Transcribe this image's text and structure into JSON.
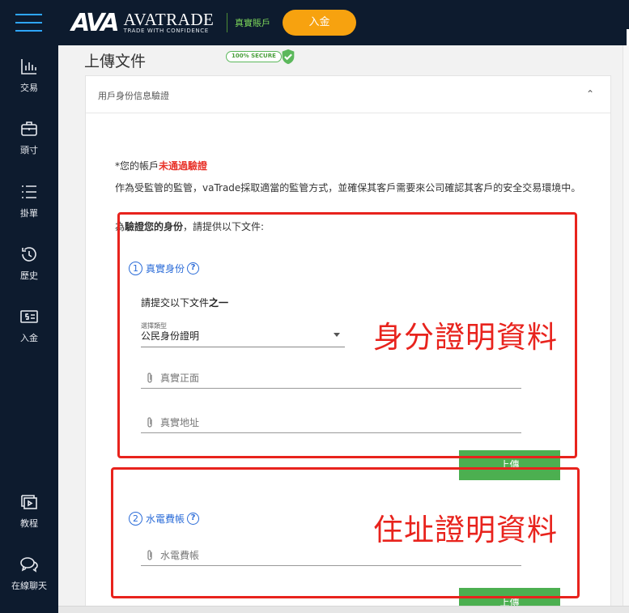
{
  "header": {
    "logo_mark": "AVA",
    "brand_name": "AVATRADE",
    "brand_tagline": "TRADE WITH CONFIDENCE",
    "account_type": "真實賬戶",
    "deposit_label": "入金"
  },
  "sidebar": {
    "items": [
      {
        "label": "交易",
        "icon": "chart-bars-icon"
      },
      {
        "label": "頭寸",
        "icon": "briefcase-icon"
      },
      {
        "label": "掛單",
        "icon": "list-icon"
      },
      {
        "label": "歷史",
        "icon": "history-icon"
      },
      {
        "label": "入金",
        "icon": "deposit-icon"
      }
    ],
    "bottom_items": [
      {
        "label": "教程",
        "icon": "video-tutorial-icon"
      },
      {
        "label": "在線聊天",
        "icon": "chat-icon"
      }
    ]
  },
  "page": {
    "title": "上傳文件",
    "secure_badge": "100% SECURE"
  },
  "card": {
    "header_title": "用戶身份信息驗證",
    "status_prefix": "*您的帳戶",
    "status_value": "未通過驗證",
    "description": "作為受監管的監管，vaTrade採取適當的監管方式，並確保其客戶需要來公司確認其客戶的安全交易環境中。",
    "request_prefix": "為",
    "request_bold": "驗證您的身份",
    "request_suffix": "，請提供以下文件:"
  },
  "identity_section": {
    "number": "1",
    "title": "真實身份",
    "help": "?",
    "instruction_prefix": "請提交以下文件",
    "instruction_bold": "之一",
    "select_label": "選擇類型",
    "select_value": "公民身份證明",
    "front_placeholder": "真實正面",
    "address_placeholder": "真實地址",
    "upload_label": "上傳"
  },
  "utility_section": {
    "number": "2",
    "title": "水電費帳",
    "help": "?",
    "bill_placeholder": "水電費帳",
    "upload_label": "上傳"
  },
  "annotations": {
    "identity_note": "身分證明資料",
    "address_note": "住址證明資料",
    "color": "#e8231d"
  },
  "colors": {
    "sidebar_bg": "#0d1b2e",
    "accent_orange": "#f7a20f",
    "upload_green": "#4caf50",
    "link_blue": "#2b6cd8"
  }
}
